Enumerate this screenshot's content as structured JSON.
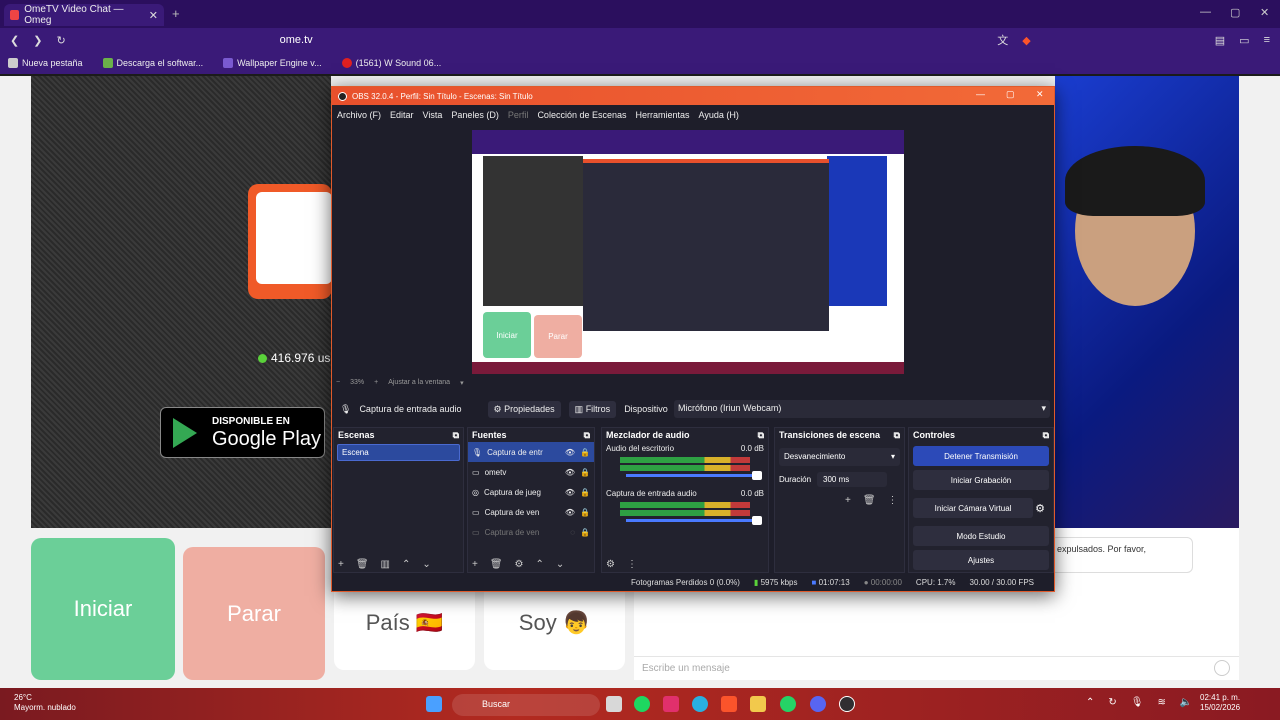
{
  "browser": {
    "tab_title": "OmeTV Video Chat — Omeg",
    "new_tab": "+",
    "url": "ome.tv",
    "bookmarks": [
      {
        "label": "Nueva pestaña",
        "color": "#cccccc"
      },
      {
        "label": "Descarga el softwar...",
        "color": "#6bb04a"
      },
      {
        "label": "Wallpaper Engine v...",
        "color": "#7a5ad0"
      },
      {
        "label": "(1561) W Sound 06...",
        "color": "#e02020"
      }
    ]
  },
  "ometv": {
    "online_count": "416.976 us",
    "gplay_line1": "DISPONIBLE EN",
    "gplay_line2": "Google Play",
    "btn_iniciar": "Iniciar",
    "btn_parar": "Parar",
    "btn_pais": "País 🇪🇸",
    "btn_soy": "Soy 👦",
    "chat_message": "expulsados. Por favor,",
    "message_placeholder": "Escribe un mensaje"
  },
  "obs": {
    "title": "OBS 32.0.4 - Perfil: Sin Título - Escenas: Sin Título",
    "menu": [
      "Archivo (F)",
      "Editar",
      "Vista",
      "Paneles (D)",
      "Perfil",
      "Colección de Escenas",
      "Herramientas",
      "Ayuda (H)"
    ],
    "preview_btn1": "Iniciar",
    "preview_btn2": "Parar",
    "zoom": "33%",
    "fit": "Ajustar a la ventana",
    "source_name": "Captura de entrada audio",
    "btn_properties": "Propiedades",
    "btn_filters": "Filtros",
    "device_label": "Dispositivo",
    "device_value": "Micrófono (Iriun Webcam)",
    "docks": {
      "scenes": {
        "title": "Escenas",
        "items": [
          "Escena"
        ]
      },
      "sources": {
        "title": "Fuentes",
        "items": [
          "Captura de entr",
          "ometv",
          "Captura de jueg",
          "Captura de ven",
          "Captura de ven"
        ]
      },
      "mixer": {
        "title": "Mezclador de audio",
        "channels": [
          {
            "name": "Audio del escritorio",
            "db": "0.0 dB"
          },
          {
            "name": "Captura de entrada audio",
            "db": "0.0 dB"
          }
        ]
      },
      "transitions": {
        "title": "Transiciones de escena",
        "selected": "Desvanecimiento",
        "duration_label": "Duración",
        "duration": "300 ms"
      },
      "controls": {
        "title": "Controles",
        "buttons": [
          "Detener Transmisión",
          "Iniciar Grabación",
          "Iniciar Cámara Virtual",
          "Modo Estudio",
          "Ajustes"
        ]
      }
    },
    "status": {
      "dropped": "Fotogramas Perdidos 0 (0.0%)",
      "bitrate": "5975 kbps",
      "stream_time": "01:07:13",
      "rec_time": "00:00:00",
      "cpu": "CPU: 1.7%",
      "fps": "30.00 / 30.00 FPS"
    }
  },
  "taskbar": {
    "temp": "26°C",
    "weather": "Mayorm. nublado",
    "search": "Buscar",
    "time": "02:41 p. m.",
    "date": "15/02/2026",
    "icons": [
      {
        "name": "windows-start-icon",
        "color": "#4aa0ff"
      },
      {
        "name": "file-explorer-icon",
        "color": "#d8d8d8"
      },
      {
        "name": "spotify-icon",
        "color": "#1ed760"
      },
      {
        "name": "instagram-icon",
        "color": "#e1306c"
      },
      {
        "name": "edge-icon",
        "color": "#2ab0e0"
      },
      {
        "name": "brave-icon",
        "color": "#fb542b"
      },
      {
        "name": "folder-icon",
        "color": "#f2c94c"
      },
      {
        "name": "whatsapp-icon",
        "color": "#25d366"
      },
      {
        "name": "discord-icon",
        "color": "#5865f2"
      },
      {
        "name": "obs-icon",
        "color": "#302e31"
      }
    ]
  }
}
